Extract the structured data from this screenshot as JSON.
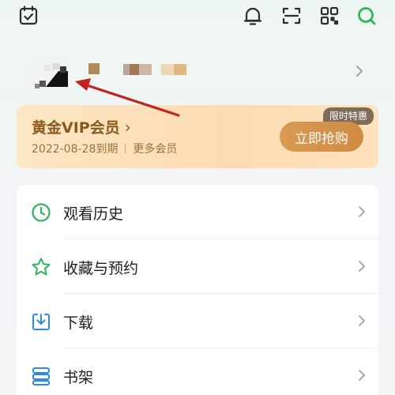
{
  "topbar": {
    "icons": [
      "calendar-check-icon",
      "bell-icon",
      "scan-icon",
      "qr-code-icon",
      "search-icon"
    ]
  },
  "profile": {
    "avatar_icon": "blurred-avatar",
    "name_blurred": true
  },
  "vip": {
    "title": "黄金VIP会员",
    "expiry": "2022-08-28到期",
    "more_members": "更多会员",
    "badge": "限时特惠",
    "buy_button": "立即抢购"
  },
  "menu": {
    "items": [
      {
        "label": "观看历史",
        "icon": "clock-icon"
      },
      {
        "label": "收藏与预约",
        "icon": "star-icon"
      },
      {
        "label": "下载",
        "icon": "download-icon"
      },
      {
        "label": "书架",
        "icon": "bookshelf-icon"
      }
    ]
  },
  "colors": {
    "accent_green": "#2fb45a",
    "vip_text": "#8a5a1c",
    "buy_button": "#d4934b",
    "annotation_arrow": "#c0241f"
  }
}
